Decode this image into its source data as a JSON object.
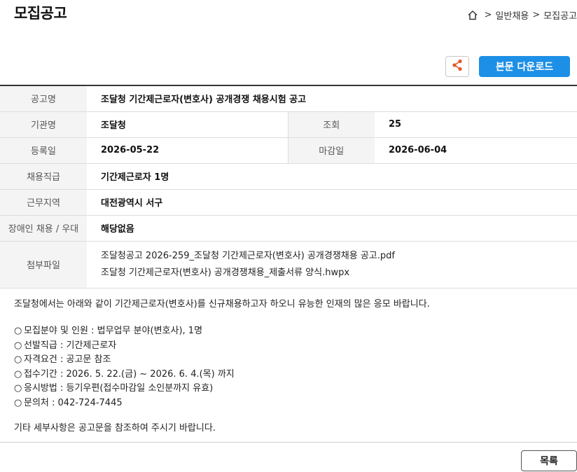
{
  "page": {
    "title": "모집공고"
  },
  "breadcrumb": {
    "home_icon": "home-icon",
    "separator": ">",
    "items": [
      "일반채용",
      "모집공고"
    ]
  },
  "toolbar": {
    "share_icon": "share-icon",
    "download_label": "본문 다운로드"
  },
  "info": {
    "title_label": "공고명",
    "title_value": "조달청 기간제근로자(변호사) 공개경쟁 채용시험 공고",
    "agency_label": "기관명",
    "agency_value": "조달청",
    "views_label": "조회",
    "views_value": "25",
    "reg_label": "등록일",
    "reg_value": "2026-05-22",
    "deadline_label": "마감일",
    "deadline_value": "2026-06-04",
    "position_label": "채용직급",
    "position_value": "기간제근로자 1명",
    "location_label": "근무지역",
    "location_value": "대전광역시 서구",
    "disability_label": "장애인 채용 / 우대",
    "disability_value": "해당없음",
    "attachments_label": "첨부파일",
    "attachments": [
      "조달청공고 2026-259_조달청 기간제근로자(변호사) 공개경쟁채용 공고.pdf",
      "조달청 기간제근로자(변호사) 공개경쟁채용_제출서류 양식.hwpx"
    ]
  },
  "body": {
    "intro": "조달청에서는 아래와 같이 기간제근로자(변호사)를 신규채용하고자 하오니 유능한 인재의 많은 응모 바랍니다.",
    "bullet_mark": "○",
    "items": [
      "모집분야 및 인원 : 법무업무 분야(변호사), 1명",
      "선발직급 : 기간제근로자",
      "자격요건 : 공고문 참조",
      "접수기간 : 2026. 5. 22.(금) ~ 2026. 6. 4.(목) 까지",
      "응시방법 : 등기우편(접수마감일 소인분까지 유효)",
      "문의처 : 042-724-7445"
    ],
    "outro": "기타 세부사항은 공고문을 참조하여 주시기 바랍니다."
  },
  "footer": {
    "list_label": "목록"
  },
  "colors": {
    "accent": "#1d8fe6",
    "share_icon": "#e8562a"
  }
}
